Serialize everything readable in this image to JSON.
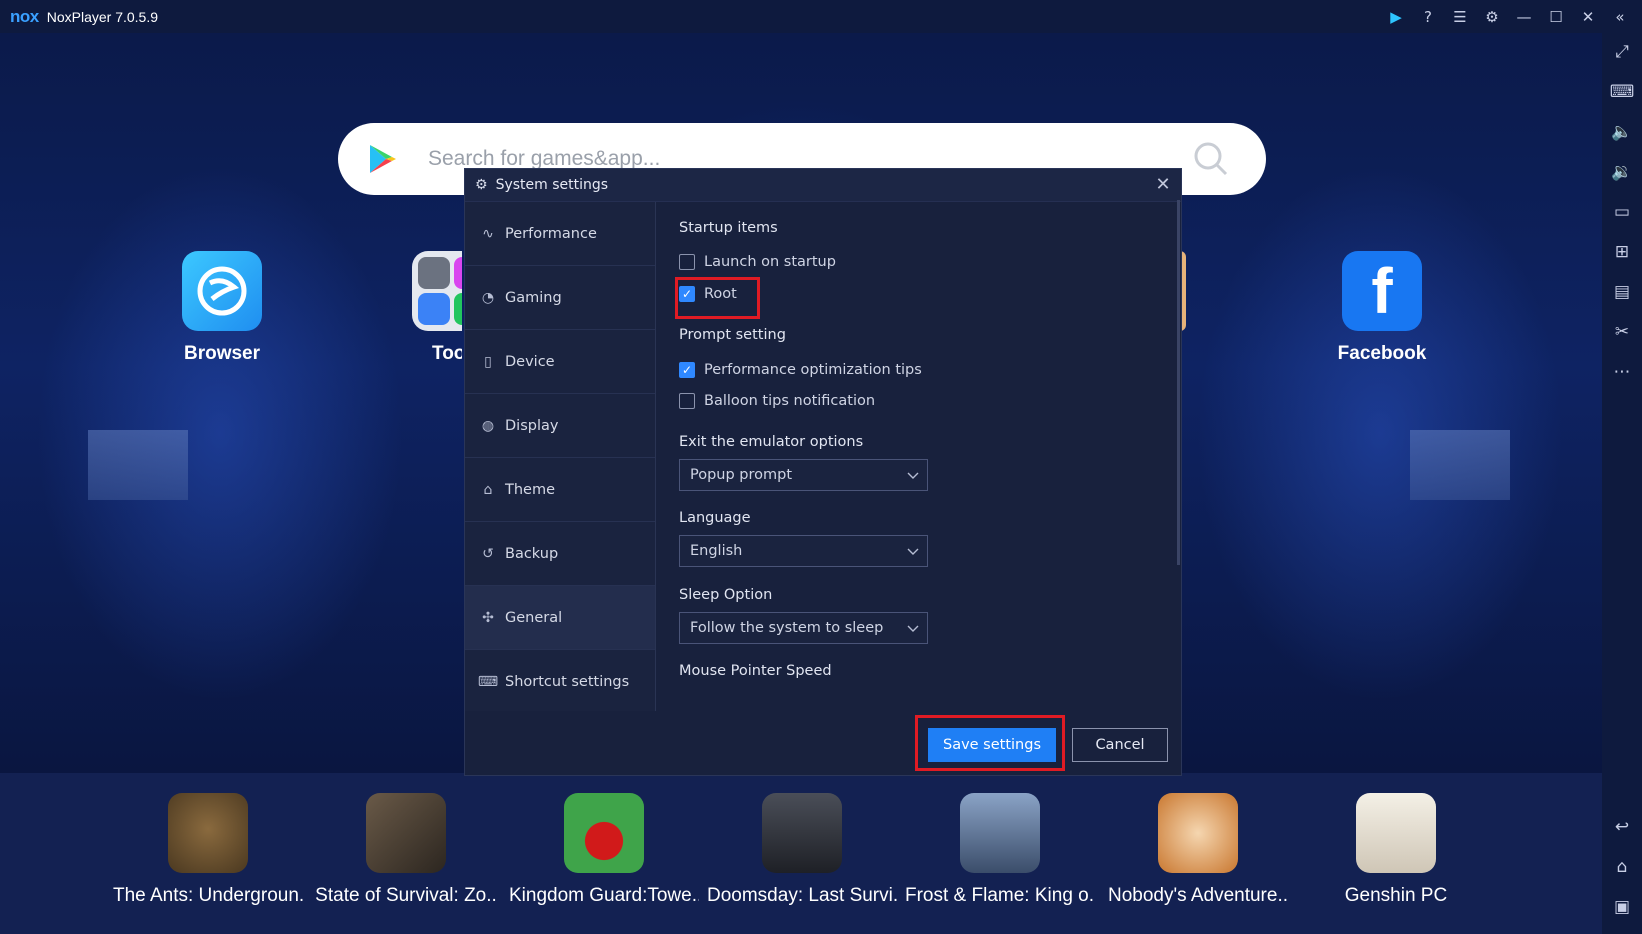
{
  "titlebar": {
    "logo": "nox",
    "app_title": "NoxPlayer 7.0.5.9",
    "icons": [
      "play-icon",
      "help-icon",
      "menu-icon",
      "gear-icon",
      "minimize-icon",
      "maximize-icon",
      "close-icon",
      "collapse-icon"
    ]
  },
  "search": {
    "placeholder": "Search for games&app..."
  },
  "desktop_apps": [
    {
      "label": "Browser"
    },
    {
      "label": "Tool"
    },
    {
      "label": "Facebook"
    }
  ],
  "sidebar": {
    "icons": [
      "fullscreen-icon",
      "keyboard-icon",
      "volume-up-icon",
      "volume-down-icon",
      "screen-icon",
      "add-apk-icon",
      "multi-instance-icon",
      "screenshot-icon",
      "more-icon",
      "back-icon",
      "home-icon",
      "recent-apps-icon"
    ]
  },
  "dock_apps": [
    {
      "label": "The Ants: Undergroun.."
    },
    {
      "label": "State of Survival: Zo.."
    },
    {
      "label": "Kingdom Guard:Towe.."
    },
    {
      "label": "Doomsday: Last Survi.."
    },
    {
      "label": "Frost & Flame: King o.."
    },
    {
      "label": "Nobody's Adventure.."
    },
    {
      "label": "Genshin PC"
    }
  ],
  "dialog": {
    "title": "System settings",
    "nav": [
      {
        "label": "Performance",
        "icon": "pulse-icon"
      },
      {
        "label": "Gaming",
        "icon": "gaming-icon"
      },
      {
        "label": "Device",
        "icon": "device-icon"
      },
      {
        "label": "Display",
        "icon": "display-icon"
      },
      {
        "label": "Theme",
        "icon": "theme-icon"
      },
      {
        "label": "Backup",
        "icon": "backup-icon"
      },
      {
        "label": "General",
        "icon": "general-icon"
      },
      {
        "label": "Shortcut settings",
        "icon": "keyboard-icon"
      }
    ],
    "active_nav": "General",
    "startup_title": "Startup items",
    "launch_on_startup": {
      "label": "Launch on startup",
      "checked": false
    },
    "root": {
      "label": "Root",
      "checked": true
    },
    "prompt_title": "Prompt setting",
    "perf_tips": {
      "label": "Performance optimization tips",
      "checked": true
    },
    "balloon_tips": {
      "label": "Balloon tips notification",
      "checked": false
    },
    "exit_title": "Exit the emulator options",
    "exit_value": "Popup prompt",
    "language_title": "Language",
    "language_value": "English",
    "sleep_title": "Sleep Option",
    "sleep_value": "Follow the system to sleep",
    "mouse_title": "Mouse Pointer Speed",
    "save_label": "Save settings",
    "cancel_label": "Cancel"
  },
  "colors": {
    "accent": "#1f7ff5",
    "highlight": "#e01b24",
    "dialog_bg": "#18213d"
  }
}
